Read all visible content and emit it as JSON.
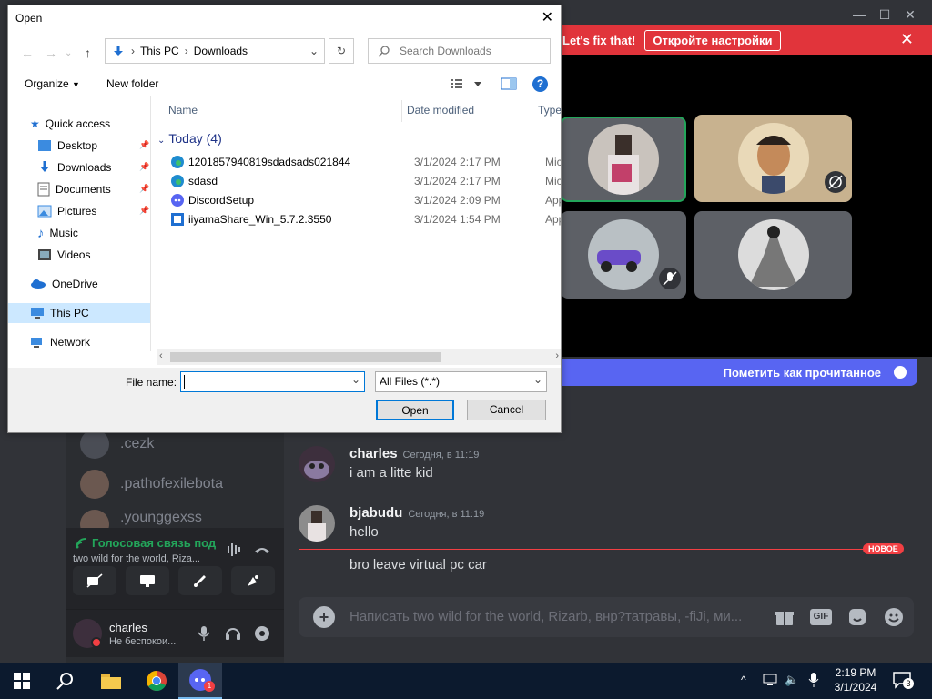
{
  "discord": {
    "notice": {
      "text": "Let's fix that!",
      "button": "Откройте настройки"
    },
    "mark_read": "Пометить как прочитанное",
    "members": [
      ".cezk",
      ".pathofexilebota",
      ".younggexss"
    ],
    "voice": {
      "status": "Голосовая связь под",
      "channel": "two wild for the world, Riza..."
    },
    "user": {
      "name": "charles",
      "status": "Не беспокои..."
    },
    "messages": [
      {
        "author": "charles",
        "time": "Сегодня, в 11:19",
        "text": "i am a litte kid"
      },
      {
        "author": "bjabudu",
        "time": "Сегодня, в 11:19",
        "text": "hello"
      },
      {
        "text": "bro leave virtual pc car"
      }
    ],
    "new_badge": "НОВОЕ",
    "composer_placeholder": "Написать two wild for the world, Rizarb, внр?татравы, -fiJi, ми...",
    "gif_label": "GIF"
  },
  "dialog": {
    "title": "Open",
    "breadcrumb": [
      "This PC",
      "Downloads"
    ],
    "search_placeholder": "Search Downloads",
    "organize": "Organize",
    "new_folder": "New folder",
    "nav": {
      "quick_access": "Quick access",
      "items": [
        "Desktop",
        "Downloads",
        "Documents",
        "Pictures",
        "Music",
        "Videos"
      ],
      "onedrive": "OneDrive",
      "this_pc": "This PC",
      "network": "Network"
    },
    "columns": {
      "name": "Name",
      "date": "Date modified",
      "type": "Type"
    },
    "group": "Today (4)",
    "files": [
      {
        "name": "1201857940819sdadsads021844",
        "date": "3/1/2024 2:17 PM",
        "type": "Micro"
      },
      {
        "name": "sdasd",
        "date": "3/1/2024 2:17 PM",
        "type": "Micro"
      },
      {
        "name": "DiscordSetup",
        "date": "3/1/2024 2:09 PM",
        "type": "Appli"
      },
      {
        "name": "iiyamaShare_Win_5.7.2.3550",
        "date": "3/1/2024 1:54 PM",
        "type": "Appli"
      }
    ],
    "file_name_label": "File name:",
    "file_name_value": "",
    "filter": "All Files (*.*)",
    "open_btn": "Open",
    "cancel_btn": "Cancel"
  },
  "taskbar": {
    "time": "2:19 PM",
    "date": "3/1/2024",
    "notif_count": "3",
    "discord_badge": "1"
  }
}
